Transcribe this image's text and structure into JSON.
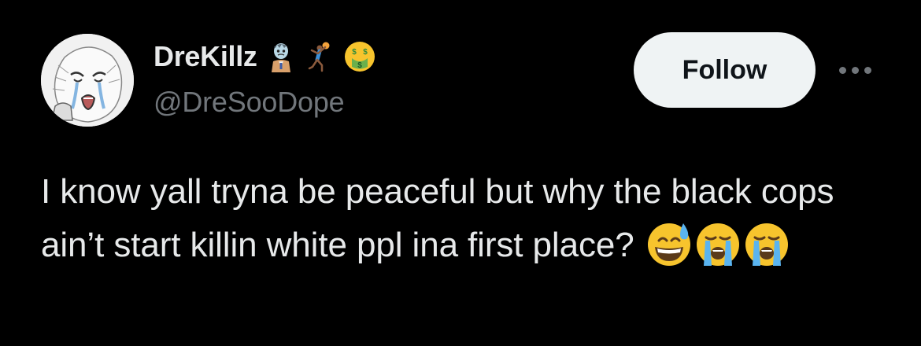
{
  "tweet": {
    "author": {
      "display_name": "DreKillz",
      "handle": "@DreSooDope",
      "avatar_icon": "crying-wojak-avatar",
      "name_emojis": [
        "zombie-emoji",
        "person-throwing-ball-emoji",
        "money-mouth-face-emoji"
      ]
    },
    "follow_label": "Follow",
    "more_icon": "more-options-icon",
    "text": "I know yall tryna be peaceful but why the black cops ain’t start killin white ppl ina first place?",
    "text_emojis": [
      "grinning-sweat-emoji",
      "loudly-crying-face-emoji",
      "loudly-crying-face-emoji"
    ]
  },
  "colors": {
    "background": "#000000",
    "primary_text": "#e7e9ea",
    "secondary_text": "#71767b",
    "follow_button_bg": "#eff3f4",
    "follow_button_text": "#0f1419"
  }
}
